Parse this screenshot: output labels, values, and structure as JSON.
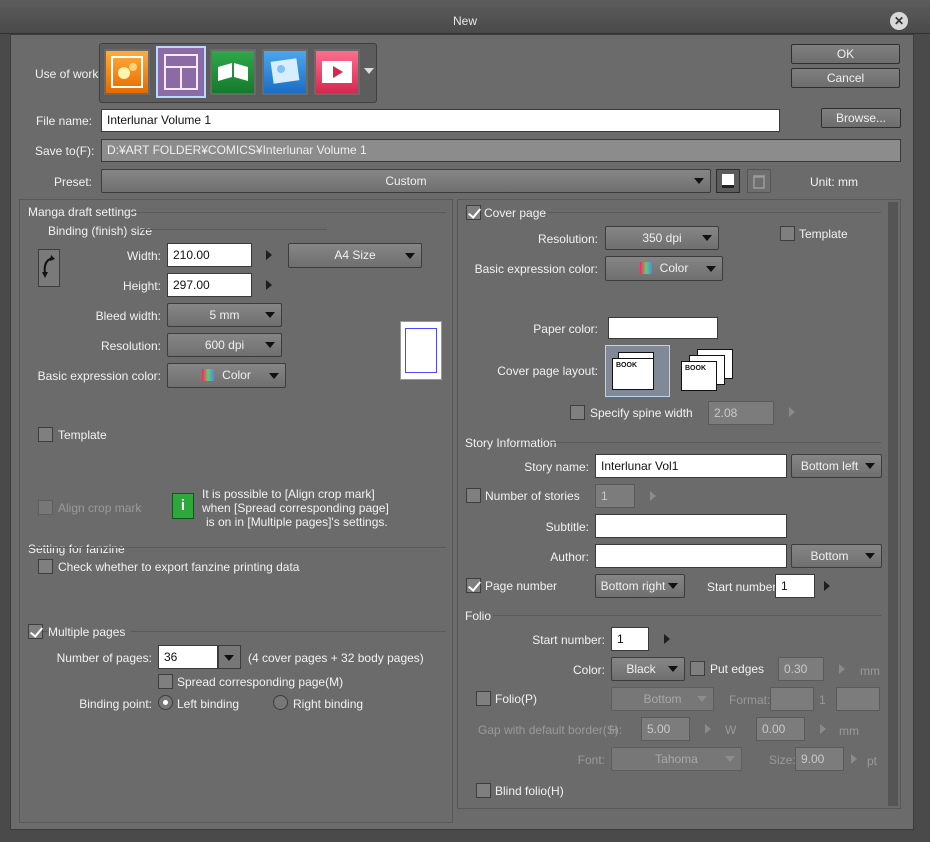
{
  "window": {
    "title": "New"
  },
  "actions": {
    "ok": "OK",
    "cancel": "Cancel",
    "browse": "Browse..."
  },
  "top": {
    "use_of_work_label": "Use of work",
    "use_of_work_icons": [
      "illustration-icon",
      "comic-icon",
      "fanzine-icon",
      "display-icon",
      "animation-icon"
    ],
    "file_name_label": "File name:",
    "file_name_value": "Interlunar Volume 1",
    "save_to_label": "Save to(F):",
    "save_to_value": "D:¥ART FOLDER¥COMICS¥Interlunar Volume 1",
    "preset_label": "Preset:",
    "preset_value": "Custom",
    "unit_label": "Unit:",
    "unit_value": "mm"
  },
  "manga": {
    "section": "Manga draft settings",
    "binding_section": "Binding (finish) size",
    "width_label": "Width:",
    "width_value": "210.00",
    "height_label": "Height:",
    "height_value": "297.00",
    "size_preset": "A4 Size",
    "bleed_label": "Bleed width:",
    "bleed_value": "5 mm",
    "resolution_label": "Resolution:",
    "resolution_value": "600 dpi",
    "color_label": "Basic expression color:",
    "color_value": "Color",
    "template_label": "Template",
    "align_crop_label": "Align crop mark",
    "info_text_1": "It is possible to [Align crop mark]",
    "info_text_2": "when [Spread corresponding page]",
    "info_text_3": "is on in [Multiple pages]'s settings."
  },
  "fanzine": {
    "section": "Setting for fanzine",
    "check_label": "Check whether to export fanzine printing data"
  },
  "multiple": {
    "label": "Multiple pages",
    "num_label": "Number of pages:",
    "num_value": "36",
    "num_note": "(4 cover pages + 32 body pages)",
    "spread_label": "Spread corresponding page(M)",
    "binding_point_label": "Binding point:",
    "left_binding": "Left binding",
    "right_binding": "Right binding"
  },
  "cover": {
    "label": "Cover page",
    "resolution_label": "Resolution:",
    "resolution_value": "350 dpi",
    "template_label": "Template",
    "color_label": "Basic expression color:",
    "color_value": "Color",
    "paper_color_label": "Paper color:",
    "layout_label": "Cover page layout:",
    "book_text": "BOOK",
    "spine_label": "Specify spine width",
    "spine_value": "2.08"
  },
  "story": {
    "section": "Story Information",
    "name_label": "Story name:",
    "name_value": "Interlunar Vol1",
    "name_position": "Bottom left",
    "num_stories_label": "Number of stories",
    "num_stories_value": "1",
    "subtitle_label": "Subtitle:",
    "subtitle_value": "",
    "author_label": "Author:",
    "author_value": "",
    "author_position": "Bottom",
    "page_number_label": "Page number",
    "page_number_position": "Bottom right",
    "start_number_label": "Start number:",
    "start_number_value": "1"
  },
  "folio": {
    "section": "Folio",
    "start_label": "Start number:",
    "start_value": "1",
    "color_label": "Color:",
    "color_value": "Black",
    "put_edges_label": "Put edges",
    "put_edges_value": "0.30",
    "put_edges_unit": "mm",
    "folio_label": "Folio(P)",
    "folio_position": "Bottom",
    "format_label": "Format:",
    "format_middle": "1",
    "gap_label": "Gap with default border(S):",
    "h_label": "H",
    "h_value": "5.00",
    "w_label": "W",
    "w_value": "0.00",
    "gap_unit": "mm",
    "font_label": "Font:",
    "font_value": "Tahoma",
    "size_label": "Size:",
    "size_value": "9.00",
    "size_unit": "pt",
    "blind_label": "Blind folio(H)"
  }
}
